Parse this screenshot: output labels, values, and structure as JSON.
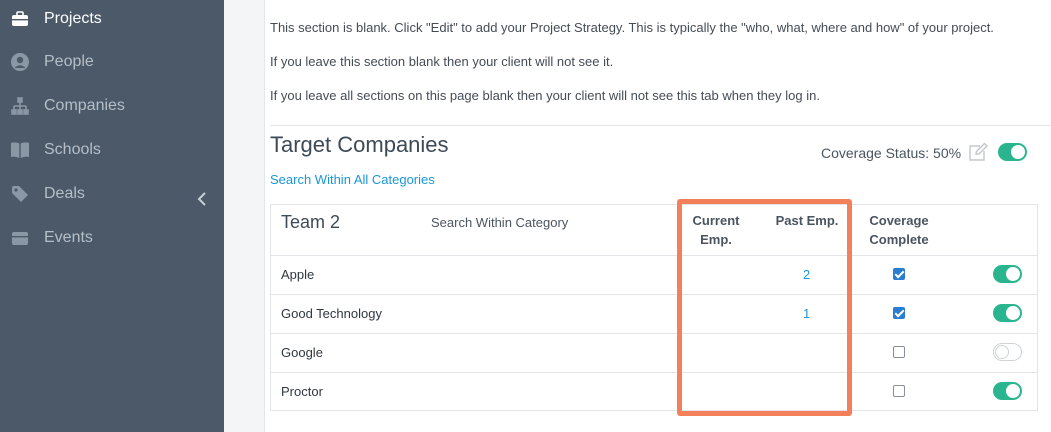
{
  "sidebar": {
    "items": [
      {
        "label": "Projects",
        "icon": "briefcase-icon"
      },
      {
        "label": "People",
        "icon": "person-icon"
      },
      {
        "label": "Companies",
        "icon": "org-chart-icon"
      },
      {
        "label": "Schools",
        "icon": "book-icon"
      },
      {
        "label": "Deals",
        "icon": "tag-icon"
      },
      {
        "label": "Events",
        "icon": "calendar-icon"
      }
    ],
    "collapse_icon": "chevron-left-icon"
  },
  "strategy": {
    "line1": "This section is blank. Click \"Edit\" to add your Project Strategy. This is typically the \"who, what, where and how\" of your project.",
    "line2": "If you leave this section blank then your client will not see it.",
    "line3": "If you leave all sections on this page blank then your client will not see this tab when they log in."
  },
  "target_companies": {
    "title": "Target Companies",
    "search_all_link": "Search Within All Categories",
    "coverage_status": "Coverage Status: 50%",
    "coverage_toggle_on": true
  },
  "table": {
    "team_name": "Team 2",
    "search_category": "Search Within Category",
    "col_current_line1": "Current",
    "col_current_line2": "Emp.",
    "col_past": "Past Emp.",
    "col_coverage_line1": "Coverage",
    "col_coverage_line2": "Complete",
    "rows": [
      {
        "company": "Apple",
        "past_emp": "2",
        "coverage_complete": true,
        "enabled": true
      },
      {
        "company": "Good Technology",
        "past_emp": "1",
        "coverage_complete": true,
        "enabled": true
      },
      {
        "company": "Google",
        "past_emp": "",
        "coverage_complete": false,
        "enabled": false
      },
      {
        "company": "Proctor",
        "past_emp": "",
        "coverage_complete": false,
        "enabled": true
      }
    ]
  },
  "colors": {
    "sidebar_bg": "#4b5968",
    "accent_link": "#1a97d6",
    "toggle_on": "#2bb58f",
    "highlight_border": "#f47f5b"
  }
}
